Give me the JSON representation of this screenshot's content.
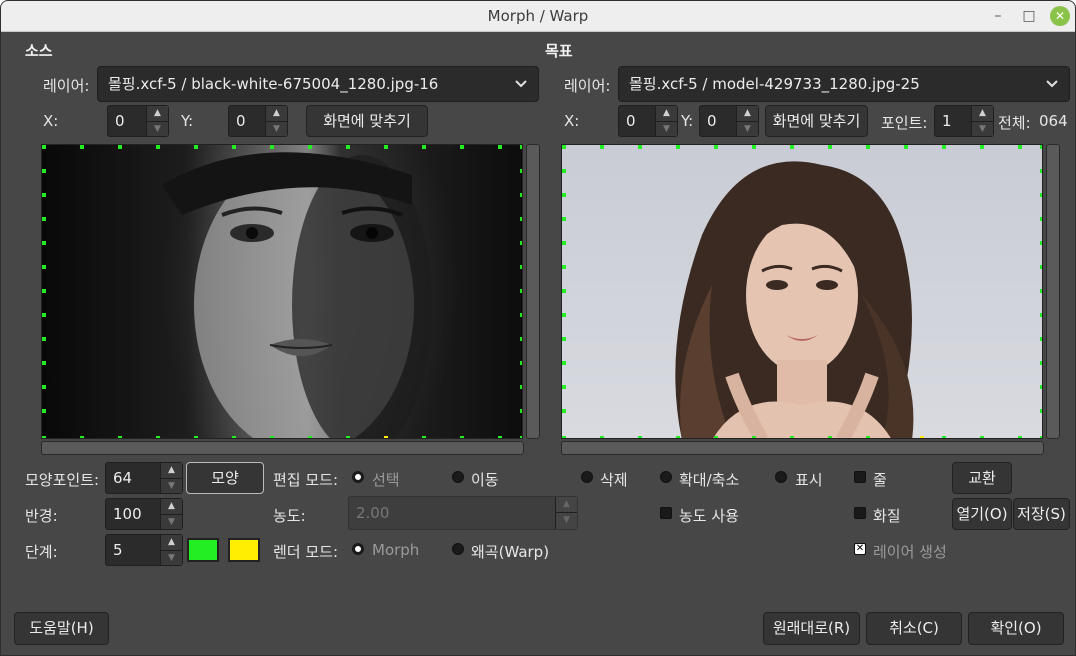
{
  "window": {
    "title": "Morph / Warp",
    "minimize": "–",
    "maximize": "□",
    "close": "✕"
  },
  "source": {
    "title": "소스",
    "layer_label": "레이어:",
    "layer_value": "몰핑.xcf-5 / black-white-675004_1280.jpg-16",
    "x_label": "X:",
    "x_value": "0",
    "y_label": "Y:",
    "y_value": "0",
    "fit_button": "화면에 맞추기"
  },
  "target": {
    "title": "목표",
    "layer_label": "레이어:",
    "layer_value": "몰핑.xcf-5 / model-429733_1280.jpg-25",
    "x_label": "X:",
    "x_value": "0",
    "y_label": "Y:",
    "y_value": "0",
    "fit_button": "화면에 맞추기",
    "point_label": "포인트:",
    "point_value": "1",
    "total_label": "전체:",
    "total_value": "064"
  },
  "controls": {
    "shape_points_label": "모양포인트:",
    "shape_points_value": "64",
    "shape_button": "모양",
    "radius_label": "반경:",
    "radius_value": "100",
    "steps_label": "단계:",
    "steps_value": "5",
    "color_green": "#22ee22",
    "color_yellow": "#ffee00",
    "edit_mode_label": "편집 모드:",
    "edit_select": "선택",
    "edit_move": "이동",
    "edit_delete": "삭제",
    "edit_zoom": "확대/축소",
    "edit_show": "표시",
    "density_label": "농도:",
    "density_value": "2.00",
    "use_density": "농도 사용",
    "render_mode_label": "렌더 모드:",
    "render_morph": "Morph",
    "render_warp": "왜곡(Warp)",
    "check_line": "줄",
    "check_quality": "화질",
    "check_create_layer": "레이어 생성",
    "swap_button": "교환",
    "open_button": "열기(O)",
    "save_button": "저장(S)"
  },
  "footer": {
    "help_button": "도움말(H)",
    "reset_button": "원래대로(R)",
    "cancel_button": "취소(C)",
    "ok_button": "확인(O)"
  }
}
